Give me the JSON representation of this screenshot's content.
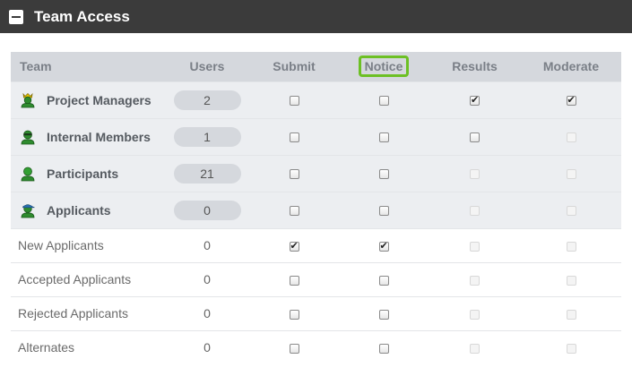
{
  "header": {
    "title": "Team Access",
    "collapse_icon": "minus-square-icon"
  },
  "columns": {
    "team": "Team",
    "users": "Users",
    "submit": "Submit",
    "notice": "Notice",
    "results": "Results",
    "moderate": "Moderate"
  },
  "highlight_color": "#6cc024",
  "groups": [
    {
      "name": "Project Managers",
      "icon": "crowned-user-icon",
      "icon_color": "#2e8b2e",
      "users": "2",
      "submit": false,
      "notice": false,
      "results": true,
      "moderate": true,
      "results_enabled": true,
      "moderate_enabled": true
    },
    {
      "name": "Internal Members",
      "icon": "masked-user-icon",
      "icon_color": "#2e8b2e",
      "users": "1",
      "submit": false,
      "notice": false,
      "results": false,
      "moderate": false,
      "results_enabled": true,
      "moderate_enabled": false
    },
    {
      "name": "Participants",
      "icon": "user-icon",
      "icon_color": "#2e8b2e",
      "users": "21",
      "submit": false,
      "notice": false,
      "results": false,
      "moderate": false,
      "results_enabled": false,
      "moderate_enabled": false
    },
    {
      "name": "Applicants",
      "icon": "capped-user-icon",
      "icon_color": "#2e8b2e",
      "users": "0",
      "submit": false,
      "notice": false,
      "results": false,
      "moderate": false,
      "results_enabled": false,
      "moderate_enabled": false
    }
  ],
  "subgroups": [
    {
      "name": "New Applicants",
      "users": "0",
      "submit": true,
      "notice": true
    },
    {
      "name": "Accepted Applicants",
      "users": "0",
      "submit": false,
      "notice": false
    },
    {
      "name": "Rejected Applicants",
      "users": "0",
      "submit": false,
      "notice": false
    },
    {
      "name": "Alternates",
      "users": "0",
      "submit": false,
      "notice": false
    }
  ]
}
